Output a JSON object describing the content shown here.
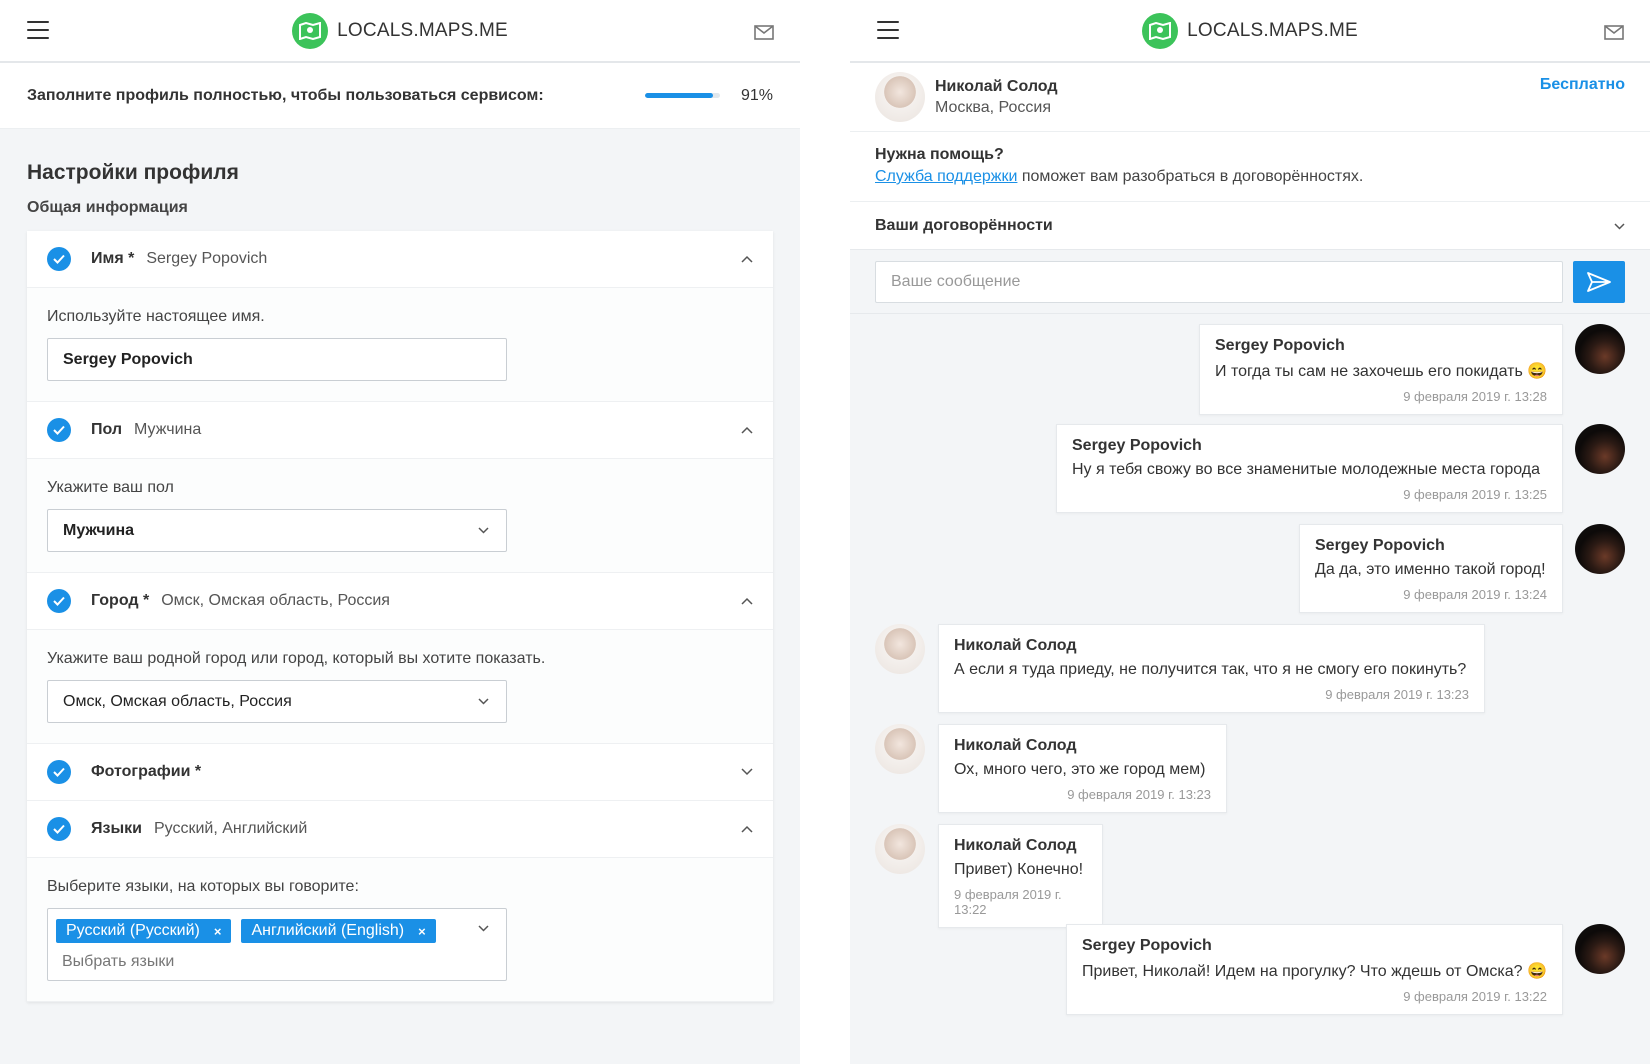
{
  "app": {
    "logo_text": "LOCALS.MAPS.ME"
  },
  "left": {
    "progress_label": "Заполните профиль полностью, чтобы пользоваться сервисом:",
    "progress_value": 91,
    "progress_text": "91%",
    "section_title": "Настройки профиля",
    "section_subtitle": "Общая информация",
    "rows": [
      {
        "name": "Имя *",
        "value": "Sergey Popovich",
        "hint": "Используйте настоящее имя.",
        "field": "Sergey Popovich"
      },
      {
        "name": "Пол",
        "value": "Мужчина",
        "hint": "Укажите ваш пол",
        "field": "Мужчина"
      },
      {
        "name": "Город *",
        "value": "Омск, Омская область, Россия",
        "hint": "Укажите ваш родной город или город, который вы хотите показать.",
        "field": "Омск, Омская область, Россия"
      },
      {
        "name": "Фотографии *",
        "value": ""
      },
      {
        "name": "Языки",
        "value": "Русский, Английский",
        "hint": "Выберите языки, на которых вы говорите:",
        "tags": [
          "Русский (Русский)",
          "Английский (English)"
        ],
        "placeholder": "Выбрать языки"
      }
    ]
  },
  "right": {
    "partner": {
      "name": "Николай Солод",
      "city": "Москва, Россия",
      "badge": "Бесплатно"
    },
    "help": {
      "question": "Нужна помощь?",
      "link": "Служба поддержки",
      "text": " поможет вам разобраться в договорённостях."
    },
    "deals_label": "Ваши договорённости",
    "compose_placeholder": "Ваше сообщение",
    "messages": [
      {
        "author": "Sergey Popovich",
        "text": "И тогда ты сам не захочешь его покидать 😄",
        "date": "9 февраля 2019 г. 13:28"
      },
      {
        "author": "Sergey Popovich",
        "text": "Ну я тебя свожу во все знаменитые молодежные места города",
        "date": "9 февраля 2019 г. 13:25"
      },
      {
        "author": "Sergey Popovich",
        "text": "Да да, это именно такой город!",
        "date": "9 февраля 2019 г. 13:24"
      },
      {
        "author": "Николай Солод",
        "text": "А если я туда приеду, не получится так, что я не смогу его покинуть?",
        "date": "9 февраля 2019 г. 13:23"
      },
      {
        "author": "Николай Солод",
        "text": "Ох, много чего, это же город мем)",
        "date": "9 февраля 2019 г. 13:23"
      },
      {
        "author": "Николай Солод",
        "text": "Привет) Конечно!",
        "date": "9 февраля 2019 г. 13:22"
      },
      {
        "author": "Sergey Popovich",
        "text": "Привет, Николай! Идем на прогулку? Что ждешь от Омска? 😄",
        "date": "9 февраля 2019 г. 13:22"
      }
    ]
  },
  "colors": {
    "accent": "#1a90e6",
    "logo": "#3cc35a"
  }
}
